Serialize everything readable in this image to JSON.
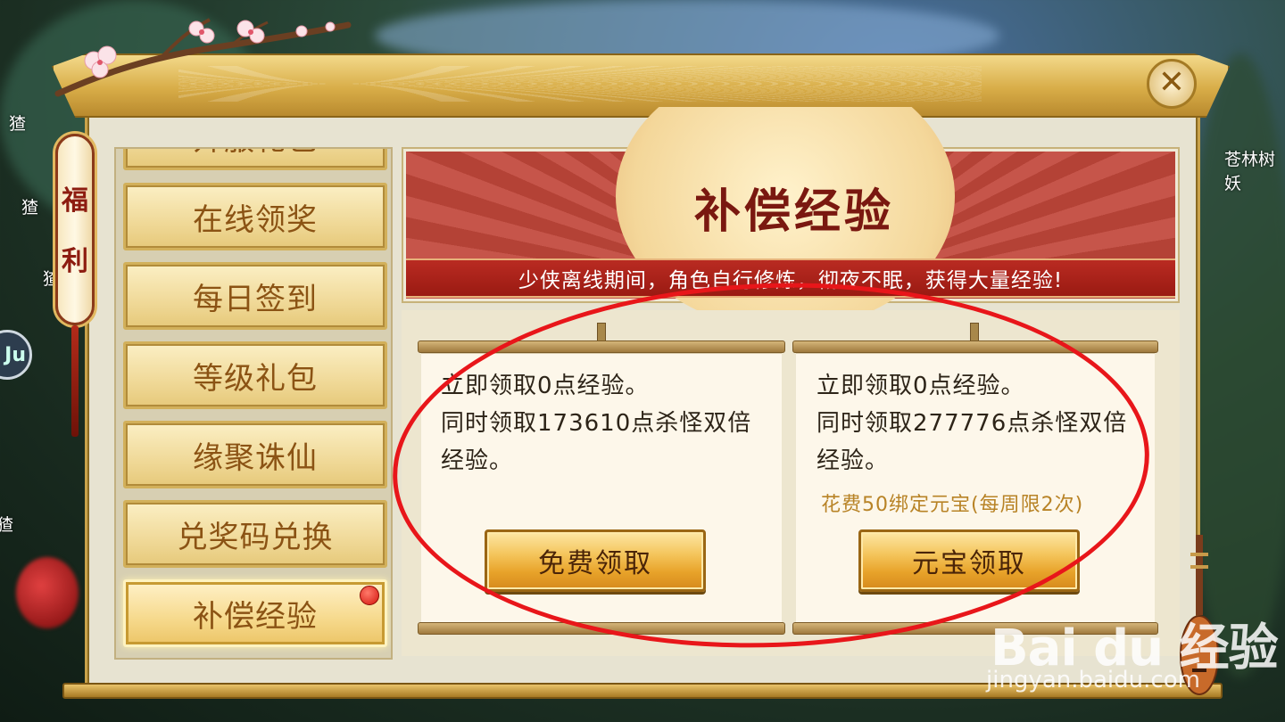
{
  "world": {
    "npc_left_1": "猹",
    "npc_left_2": "猹",
    "npc_left_3": "猹",
    "npc_left_4": "猹",
    "npc_right": "苍林树妖",
    "hud_circle": "Ju"
  },
  "panel": {
    "lantern_label_1": "福",
    "lantern_label_2": "利",
    "close_glyph": "✕"
  },
  "sidebar": {
    "partial_item": "开服礼包",
    "items": [
      {
        "label": "在线领奖"
      },
      {
        "label": "每日签到"
      },
      {
        "label": "等级礼包"
      },
      {
        "label": "缘聚诛仙"
      },
      {
        "label": "兑奖码兑换"
      },
      {
        "label": "补偿经验"
      }
    ],
    "active_index": 5
  },
  "banner": {
    "title": "补偿经验",
    "subtitle": "少侠离线期间，角色自行修炼，彻夜不眠，获得大量经验!"
  },
  "cards": [
    {
      "line1": "立即领取0点经验。",
      "line2": "同时领取173610点杀怪双倍",
      "line3": "经验。",
      "cost": "",
      "button": "免费领取"
    },
    {
      "line1": "立即领取0点经验。",
      "line2": "同时领取277776点杀怪双倍",
      "line3": "经验。",
      "cost": "花费50绑定元宝(每周限2次)",
      "button": "元宝领取"
    }
  ],
  "watermark": {
    "logo": "Bai du 经验",
    "url": "jingyan.baidu.com"
  },
  "colors": {
    "accent_gold": "#d8ad48",
    "banner_red": "#b44236",
    "annotation_red": "#e8161a",
    "menu_text": "#8b5314"
  }
}
